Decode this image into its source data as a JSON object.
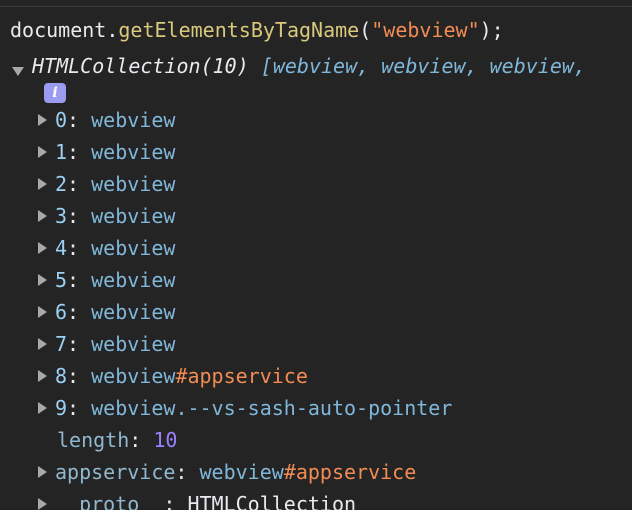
{
  "command": {
    "object": "document",
    "dot": ".",
    "method": "getElementsByTagName",
    "open": "(",
    "arg": "\"webview\"",
    "close": ");"
  },
  "result": {
    "type": "HTMLCollection(10)",
    "preview_open": "[",
    "preview_items": [
      "webview",
      "webview",
      "webview"
    ],
    "sep": ", ",
    "trail": ","
  },
  "info_icon": "i",
  "items": [
    {
      "key": "0",
      "tag": "webview",
      "suffix": ""
    },
    {
      "key": "1",
      "tag": "webview",
      "suffix": ""
    },
    {
      "key": "2",
      "tag": "webview",
      "suffix": ""
    },
    {
      "key": "3",
      "tag": "webview",
      "suffix": ""
    },
    {
      "key": "4",
      "tag": "webview",
      "suffix": ""
    },
    {
      "key": "5",
      "tag": "webview",
      "suffix": ""
    },
    {
      "key": "6",
      "tag": "webview",
      "suffix": ""
    },
    {
      "key": "7",
      "tag": "webview",
      "suffix": ""
    },
    {
      "key": "8",
      "tag": "webview",
      "suffix": "#appservice"
    },
    {
      "key": "9",
      "tag": "webview",
      "suffix": ".--vs-sash-auto-pointer"
    }
  ],
  "length": {
    "key": "length",
    "value": "10"
  },
  "appservice": {
    "key": "appservice",
    "tag": "webview",
    "suffix": "#appservice"
  },
  "proto": {
    "key": "__proto__",
    "value": "HTMLCollection"
  },
  "colon": ": "
}
